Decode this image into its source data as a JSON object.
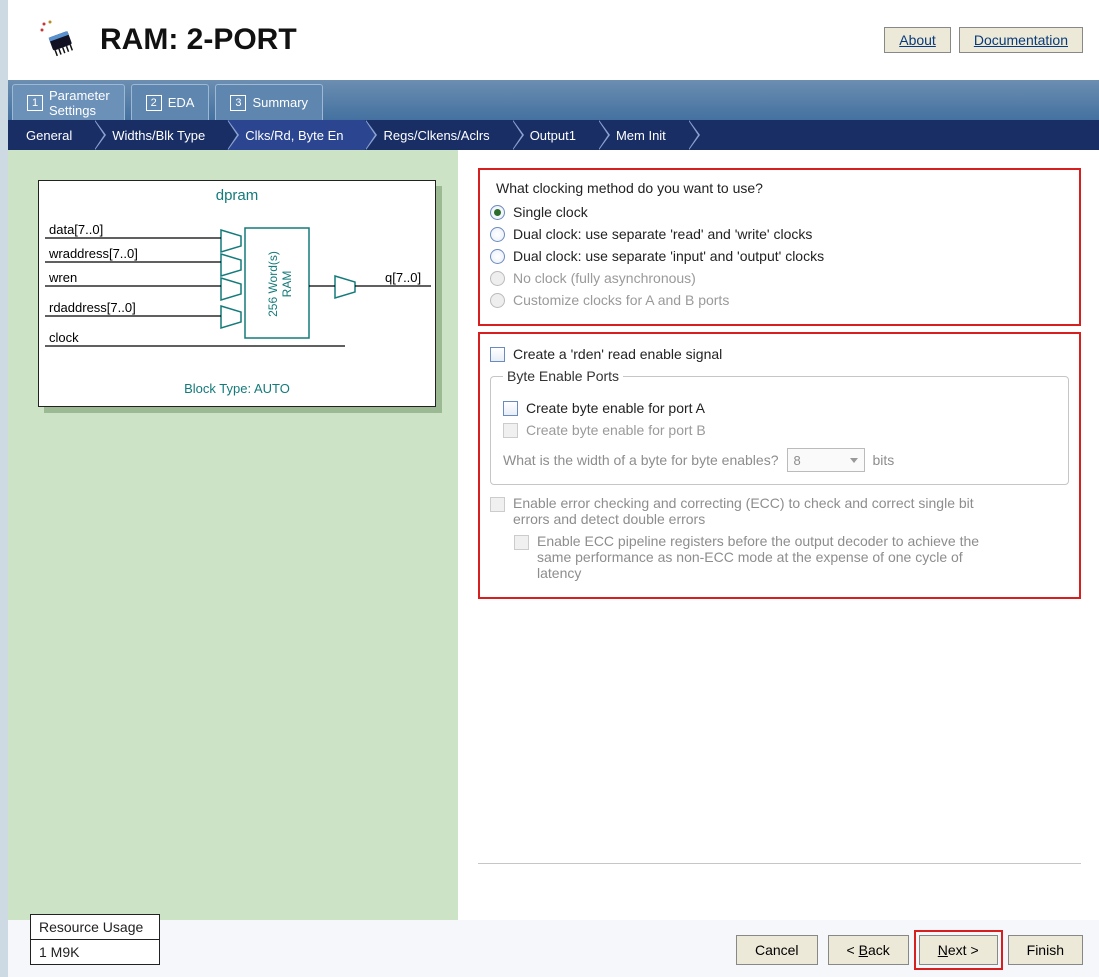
{
  "header": {
    "title": "RAM: 2-PORT",
    "about": "About",
    "documentation": "Documentation"
  },
  "topTabs": [
    {
      "num": "1",
      "label": "Parameter\nSettings",
      "active": true
    },
    {
      "num": "2",
      "label": "EDA",
      "active": false
    },
    {
      "num": "3",
      "label": "Summary",
      "active": false
    }
  ],
  "nav": [
    "General",
    "Widths/Blk Type",
    "Clks/Rd, Byte En",
    "Regs/Clkens/Aclrs",
    "Output1",
    "Mem Init"
  ],
  "nav_active": 2,
  "diagram": {
    "title": "dpram",
    "ports_left": [
      "data[7..0]",
      "wraddress[7..0]",
      "wren",
      "rdaddress[7..0]",
      "clock"
    ],
    "port_right": "q[7..0]",
    "ram_label": "256 Word(s)\nRAM",
    "block_type_label": "Block Type: AUTO"
  },
  "clocking": {
    "legend": "What clocking method do you want to use?",
    "options": [
      {
        "label": "Single clock",
        "selected": true,
        "enabled": true
      },
      {
        "label": "Dual clock: use separate 'read' and 'write' clocks",
        "selected": false,
        "enabled": true
      },
      {
        "label": "Dual clock: use separate 'input' and 'output' clocks",
        "selected": false,
        "enabled": true
      },
      {
        "label": "No clock (fully asynchronous)",
        "selected": false,
        "enabled": false
      },
      {
        "label": "Customize clocks for A and B ports",
        "selected": false,
        "enabled": false
      }
    ]
  },
  "rden": {
    "label": "Create a 'rden' read enable signal",
    "checked": false,
    "enabled": true
  },
  "byteEnable": {
    "legend": "Byte Enable Ports",
    "portA": {
      "label": "Create byte enable for port A",
      "checked": false,
      "enabled": true
    },
    "portB": {
      "label": "Create byte enable for port B",
      "checked": false,
      "enabled": false
    },
    "widthQuestion": "What is the width of a byte for byte enables?",
    "widthValue": "8",
    "widthUnits": "bits"
  },
  "ecc": {
    "main": "Enable error checking and correcting (ECC) to check and correct single bit errors and detect double errors",
    "pipeline": "Enable ECC pipeline registers before the output decoder to achieve the same performance as non-ECC mode at the expense of one cycle of latency"
  },
  "resource": {
    "title": "Resource Usage",
    "value": "1 M9K"
  },
  "buttons": {
    "cancel": "Cancel",
    "back_prefix": "< ",
    "back_u": "B",
    "back_rest": "ack",
    "next_u": "N",
    "next_rest": "ext >",
    "finish": "Finish"
  }
}
